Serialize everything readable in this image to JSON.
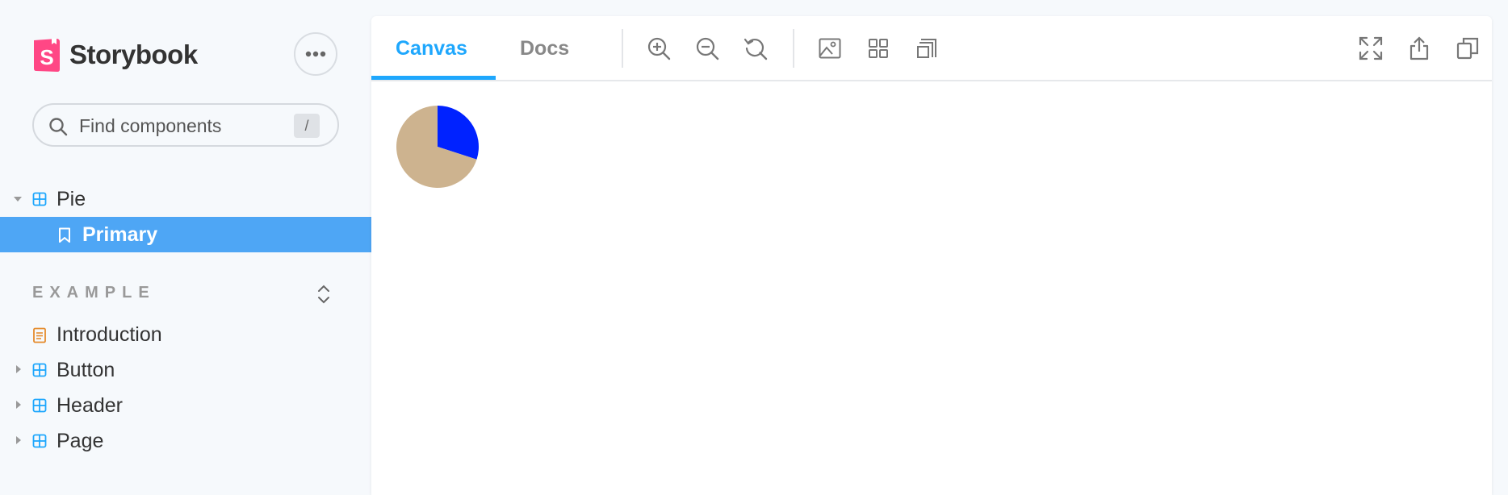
{
  "brand": {
    "name": "Storybook"
  },
  "search": {
    "placeholder": "Find components",
    "shortcut": "/"
  },
  "tree": {
    "pie": {
      "label": "Pie"
    },
    "primary": {
      "label": "Primary"
    }
  },
  "section": {
    "title": "EXAMPLE"
  },
  "example_items": [
    {
      "label": "Introduction",
      "icon": "document-icon"
    },
    {
      "label": "Button",
      "icon": "component-icon"
    },
    {
      "label": "Header",
      "icon": "component-icon"
    },
    {
      "label": "Page",
      "icon": "component-icon"
    }
  ],
  "tabs": [
    {
      "label": "Canvas",
      "active": true
    },
    {
      "label": "Docs",
      "active": false
    }
  ],
  "colors": {
    "accent": "#1ea7fd",
    "selected_bg": "#4ea6f5",
    "pie_slice_1": "#0022ff",
    "pie_slice_2": "#cdb38f"
  },
  "chart_data": {
    "type": "pie",
    "values": [
      30,
      70
    ]
  }
}
